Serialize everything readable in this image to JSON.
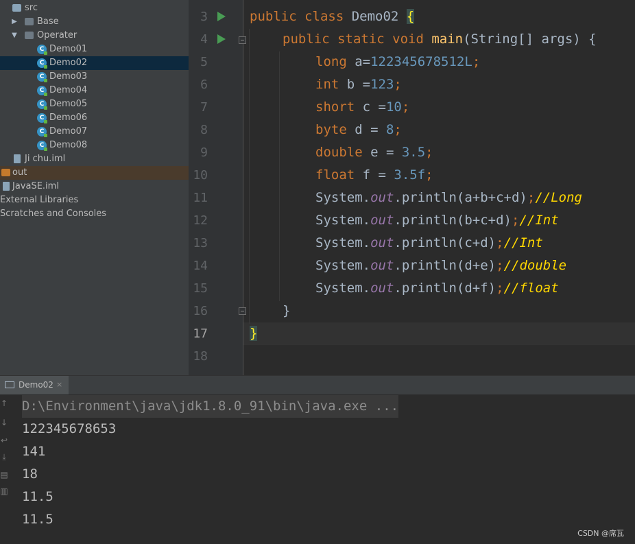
{
  "project_tree": {
    "items": [
      {
        "label": "src",
        "icon": "folder-icon"
      },
      {
        "label": "Base",
        "icon": "package-icon"
      },
      {
        "label": "Operater",
        "icon": "package-icon"
      },
      {
        "label": "Demo01",
        "icon": "java-class-icon"
      },
      {
        "label": "Demo02",
        "icon": "java-class-icon",
        "selected": true
      },
      {
        "label": "Demo03",
        "icon": "java-class-icon"
      },
      {
        "label": "Demo04",
        "icon": "java-class-icon"
      },
      {
        "label": "Demo05",
        "icon": "java-class-icon"
      },
      {
        "label": "Demo06",
        "icon": "java-class-icon"
      },
      {
        "label": "Demo07",
        "icon": "java-class-icon"
      },
      {
        "label": "Demo08",
        "icon": "java-class-icon"
      },
      {
        "label": "Ji chu.iml",
        "icon": "module-file-icon"
      },
      {
        "label": "out",
        "icon": "folder-icon"
      },
      {
        "label": "JavaSE.iml",
        "icon": "module-file-icon"
      },
      {
        "label": "External Libraries",
        "icon": ""
      },
      {
        "label": "Scratches and Consoles",
        "icon": ""
      }
    ]
  },
  "editor": {
    "line_numbers": [
      "3",
      "4",
      "5",
      "6",
      "7",
      "8",
      "9",
      "10",
      "11",
      "12",
      "13",
      "14",
      "15",
      "16",
      "17",
      "18"
    ],
    "current_line": "17",
    "code": {
      "l3_kw": "public class ",
      "l3_name": "Demo02 ",
      "l3_brace": "{",
      "l4_kw": "public static void ",
      "l4_fn": "main",
      "l4_rest": "(String[] args) {",
      "l5_kw": "long ",
      "l5_var": "a=",
      "l5_num": "122345678512L",
      "l5_semi": ";",
      "l6_kw": "int ",
      "l6_var": "b =",
      "l6_num": "123",
      "l6_semi": ";",
      "l7_kw": "short ",
      "l7_var": "c =",
      "l7_num": "10",
      "l7_semi": ";",
      "l8_kw": "byte ",
      "l8_var": "d = ",
      "l8_num": "8",
      "l8_semi": ";",
      "l9_kw": "double ",
      "l9_var": "e = ",
      "l9_num": "3.5",
      "l9_semi": ";",
      "l10_kw": "float ",
      "l10_var": "f = ",
      "l10_num": "3.5f",
      "l10_semi": ";",
      "print_prefix": "System.",
      "print_field": "out",
      "l11_call": ".println(a+b+c+d)",
      "l11_comment": "//Long",
      "l12_call": ".println(b+c+d)",
      "l12_comment": "//Int",
      "l13_call": ".println(c+d)",
      "l13_comment": "//Int",
      "l14_call": ".println(d+e)",
      "l14_comment": "//double",
      "l15_call": ".println(d+f)",
      "l15_comment": "//float",
      "semi": ";",
      "l16_brace": "}",
      "l17_brace": "}"
    }
  },
  "run_panel": {
    "tab_label": "Demo02",
    "close_glyph": "×",
    "command": "D:\\Environment\\java\\jdk1.8.0_91\\bin\\java.exe ...",
    "output": [
      "122345678653",
      "141",
      "18",
      "11.5",
      "11.5"
    ]
  },
  "watermark": "CSDN @席瓦",
  "colors": {
    "keyword": "#cc7832",
    "number": "#6897bb",
    "method": "#ffc66d",
    "field": "#9876aa",
    "comment": "#ffd700",
    "selection": "#0d293e"
  }
}
